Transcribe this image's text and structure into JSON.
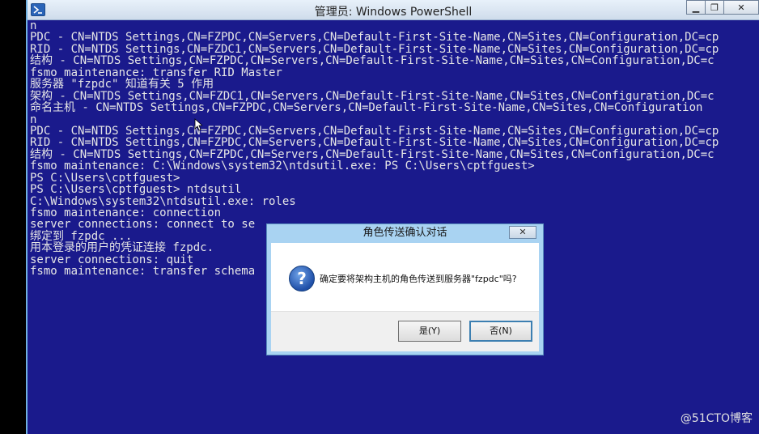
{
  "window": {
    "title": "管理员: Windows PowerShell",
    "controls": {
      "minimize": "▁",
      "maximize": "❐",
      "close": "✕"
    }
  },
  "console": {
    "lines": [
      "n",
      "PDC - CN=NTDS Settings,CN=FZPDC,CN=Servers,CN=Default-First-Site-Name,CN=Sites,CN=Configuration,DC=cp",
      "RID - CN=NTDS Settings,CN=FZDC1,CN=Servers,CN=Default-First-Site-Name,CN=Sites,CN=Configuration,DC=cp",
      "结构 - CN=NTDS Settings,CN=FZPDC,CN=Servers,CN=Default-First-Site-Name,CN=Sites,CN=Configuration,DC=c",
      "fsmo maintenance: transfer RID Master",
      "服务器 \"fzpdc\" 知道有关 5 作用",
      "架构 - CN=NTDS Settings,CN=FZDC1,CN=Servers,CN=Default-First-Site-Name,CN=Sites,CN=Configuration,DC=c",
      "命名主机 - CN=NTDS Settings,CN=FZPDC,CN=Servers,CN=Default-First-Site-Name,CN=Sites,CN=Configuration",
      "n",
      "PDC - CN=NTDS Settings,CN=FZPDC,CN=Servers,CN=Default-First-Site-Name,CN=Sites,CN=Configuration,DC=cp",
      "RID - CN=NTDS Settings,CN=FZPDC,CN=Servers,CN=Default-First-Site-Name,CN=Sites,CN=Configuration,DC=cp",
      "结构 - CN=NTDS Settings,CN=FZPDC,CN=Servers,CN=Default-First-Site-Name,CN=Sites,CN=Configuration,DC=c",
      "fsmo maintenance: C:\\Windows\\system32\\ntdsutil.exe: PS C:\\Users\\cptfguest>",
      "PS C:\\Users\\cptfguest>",
      "PS C:\\Users\\cptfguest> ntdsutil",
      "C:\\Windows\\system32\\ntdsutil.exe: roles",
      "fsmo maintenance: connection",
      "server connections: connect to se",
      "绑定到 fzpdc ...",
      "用本登录的用户的凭证连接 fzpdc.",
      "server connections: quit",
      "fsmo maintenance: transfer schema"
    ]
  },
  "dialog": {
    "title": "角色传送确认对话",
    "close_label": "✕",
    "icon_glyph": "?",
    "message": "确定要将架构主机的角色传送到服务器\"fzpdc\"吗?",
    "yes_label": "是(Y)",
    "no_label": "否(N)"
  },
  "watermark": "@51CTO博客"
}
